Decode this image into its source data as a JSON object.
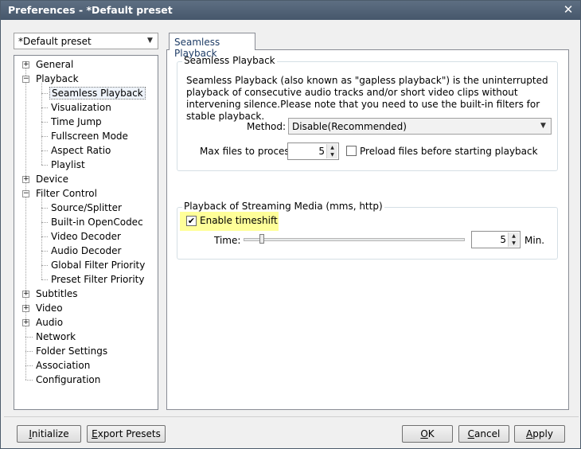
{
  "window": {
    "title": "Preferences - *Default preset",
    "close_glyph": "✕"
  },
  "preset_selector": {
    "value": "*Default preset"
  },
  "tree": {
    "items": [
      {
        "label": "General",
        "expander": "+"
      },
      {
        "label": "Playback",
        "expander": "−"
      },
      {
        "label": "Seamless Playback",
        "selected": true
      },
      {
        "label": "Visualization"
      },
      {
        "label": "Time Jump"
      },
      {
        "label": "Fullscreen Mode"
      },
      {
        "label": "Aspect Ratio"
      },
      {
        "label": "Playlist"
      },
      {
        "label": "Device",
        "expander": "+"
      },
      {
        "label": "Filter Control",
        "expander": "−"
      },
      {
        "label": "Source/Splitter"
      },
      {
        "label": "Built-in OpenCodec"
      },
      {
        "label": "Video Decoder"
      },
      {
        "label": "Audio Decoder"
      },
      {
        "label": "Global Filter Priority"
      },
      {
        "label": "Preset Filter Priority"
      },
      {
        "label": "Subtitles",
        "expander": "+"
      },
      {
        "label": "Video",
        "expander": "+"
      },
      {
        "label": "Audio",
        "expander": "+"
      },
      {
        "label": "Network"
      },
      {
        "label": "Folder Settings"
      },
      {
        "label": "Association"
      },
      {
        "label": "Configuration"
      }
    ]
  },
  "tab": {
    "label": "Seamless Playback"
  },
  "seamless_group": {
    "title": "Seamless Playback",
    "description": "Seamless Playback (also known as \"gapless playback\") is the uninterrupted playback of consecutive audio tracks and/or short video clips without intervening silence.Please note that you need to use the built-in filters for stable playback.",
    "method_label": "Method:",
    "method_value": "Disable(Recommended)",
    "max_files_label": "Max files to process:",
    "max_files_value": "5",
    "preload_label": "Preload files before starting playback",
    "preload_checked": false
  },
  "streaming_group": {
    "title": "Playback of Streaming Media (mms, http)",
    "timeshift_label": "Enable timeshift",
    "timeshift_checked": true,
    "checkmark": "✔",
    "time_label": "Time:",
    "time_value": "5",
    "time_unit": "Min.",
    "highlight_color": "#ffff99"
  },
  "buttons": {
    "initialize": {
      "prefix": "",
      "underlined": "I",
      "rest": "nitialize"
    },
    "export": {
      "prefix": "",
      "underlined": "E",
      "rest": "xport Presets"
    },
    "ok": {
      "prefix": "",
      "underlined": "O",
      "rest": "K"
    },
    "cancel": {
      "prefix": "",
      "underlined": "C",
      "rest": "ancel"
    },
    "apply": {
      "prefix": "",
      "underlined": "A",
      "rest": "pply"
    }
  }
}
